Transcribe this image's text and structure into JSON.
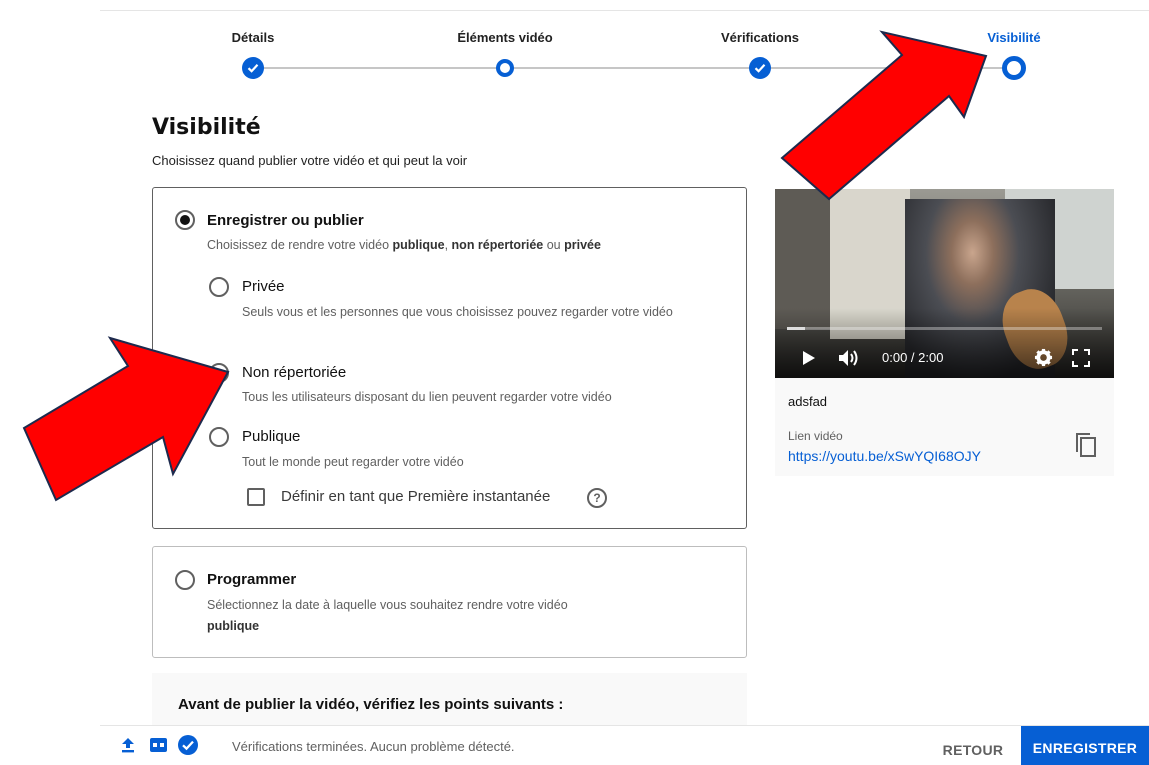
{
  "stepper": {
    "steps": [
      {
        "label": "Détails",
        "state": "done"
      },
      {
        "label": "Éléments vidéo",
        "state": "pending"
      },
      {
        "label": "Vérifications",
        "state": "done"
      },
      {
        "label": "Visibilité",
        "state": "active"
      }
    ]
  },
  "page": {
    "title": "Visibilité",
    "subtitle": "Choisissez quand publier votre vidéo et qui peut la voir"
  },
  "publish": {
    "title": "Enregistrer ou publier",
    "desc_prefix": "Choisissez de rendre votre vidéo ",
    "desc_public": "publique",
    "desc_sep": ", ",
    "desc_unlisted": "non répertoriée",
    "desc_or": " ou ",
    "desc_private": "privée",
    "options": [
      {
        "label": "Privée",
        "desc": "Seuls vous et les personnes que vous choisissez pouvez regarder votre vidéo"
      },
      {
        "label": "Non répertoriée",
        "desc": "Tous les utilisateurs disposant du lien peuvent regarder votre vidéo"
      },
      {
        "label": "Publique",
        "desc": "Tout le monde peut regarder votre vidéo"
      }
    ],
    "premiere_label": "Définir en tant que Première instantanée",
    "help_glyph": "?"
  },
  "schedule": {
    "title": "Programmer",
    "desc": "Sélectionnez la date à laquelle vous souhaitez rendre votre vidéo",
    "desc_bold": "publique"
  },
  "video": {
    "time": "0:00 / 2:00",
    "name": "adsfad",
    "link_label": "Lien vidéo",
    "link": "https://youtu.be/xSwYQI68OJY"
  },
  "checklist": {
    "title": "Avant de publier la vidéo, vérifiez les points suivants :"
  },
  "footer": {
    "status": "Vérifications terminées. Aucun problème détecté.",
    "back_label": "RETOUR",
    "save_label": "ENREGISTRER"
  },
  "colors": {
    "accent": "#065fd4",
    "annotation_arrow": "#ff0000"
  }
}
